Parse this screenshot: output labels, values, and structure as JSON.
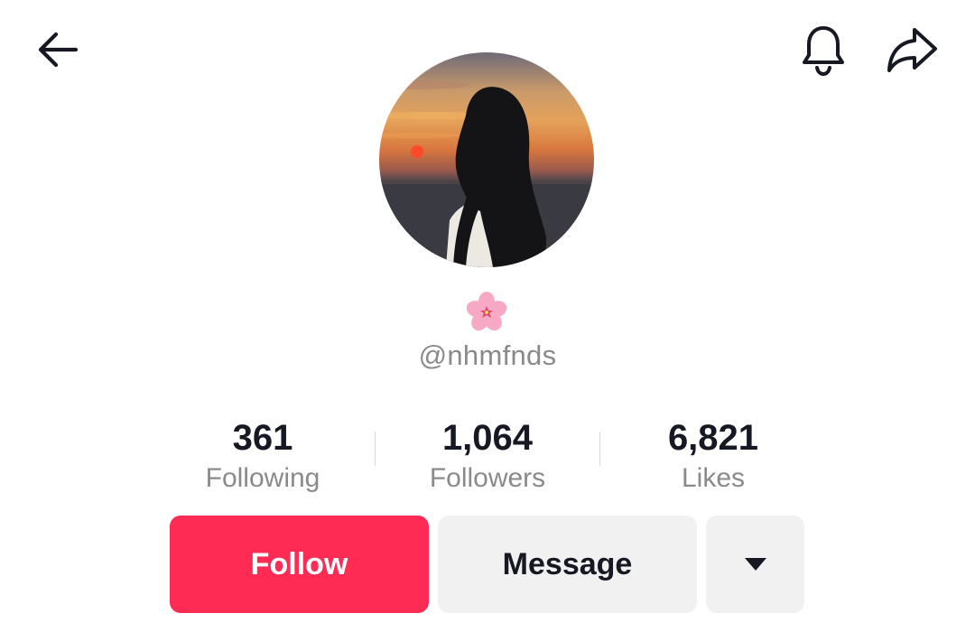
{
  "header": {
    "back_icon": "arrow-left-icon",
    "notification_icon": "bell-icon",
    "share_icon": "share-arrow-icon"
  },
  "profile": {
    "avatar_desc_icon": "profile-avatar",
    "badge_icon": "cherry-blossom-icon",
    "username": "@nhmfnds"
  },
  "stats": [
    {
      "value": "361",
      "label": "Following"
    },
    {
      "value": "1,064",
      "label": "Followers"
    },
    {
      "value": "6,821",
      "label": "Likes"
    }
  ],
  "actions": {
    "follow_label": "Follow",
    "message_label": "Message",
    "more_icon": "caret-down-icon"
  },
  "colors": {
    "follow_bg": "#fe2c55",
    "button_bg": "#f1f1f2",
    "text_primary": "#161823",
    "text_secondary": "#8a8a8a"
  }
}
